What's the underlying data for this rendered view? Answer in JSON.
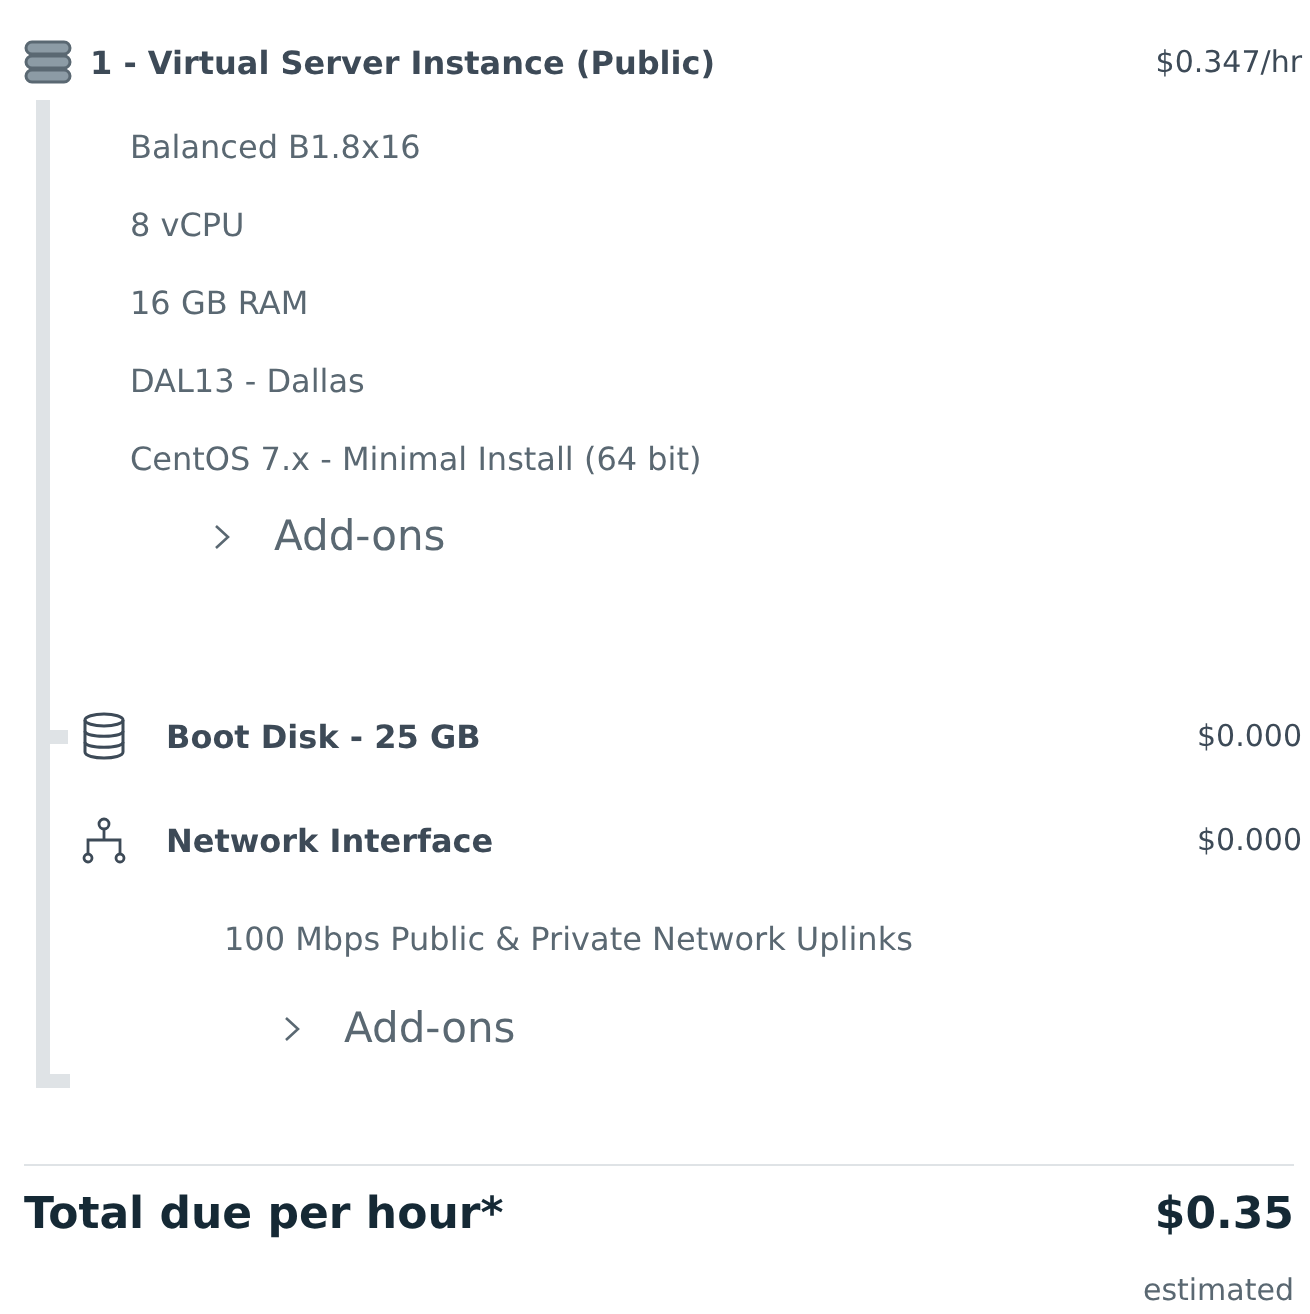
{
  "instance": {
    "title": "1 - Virtual Server Instance (Public)",
    "price": "$0.347/hr",
    "specs": [
      "Balanced B1.8x16",
      "8 vCPU",
      "16 GB RAM",
      "DAL13 - Dallas",
      "CentOS 7.x - Minimal Install (64 bit)"
    ],
    "addons_label": "Add-ons"
  },
  "components": [
    {
      "kind": "disk",
      "title": "Boot Disk - 25 GB",
      "price": "$0.000"
    },
    {
      "kind": "network",
      "title": "Network Interface",
      "price": "$0.000",
      "details": [
        "100 Mbps Public & Private Network Uplinks"
      ],
      "addons_label": "Add-ons"
    }
  ],
  "total": {
    "label": "Total due per hour*",
    "amount": "$0.35",
    "note": "estimated"
  }
}
